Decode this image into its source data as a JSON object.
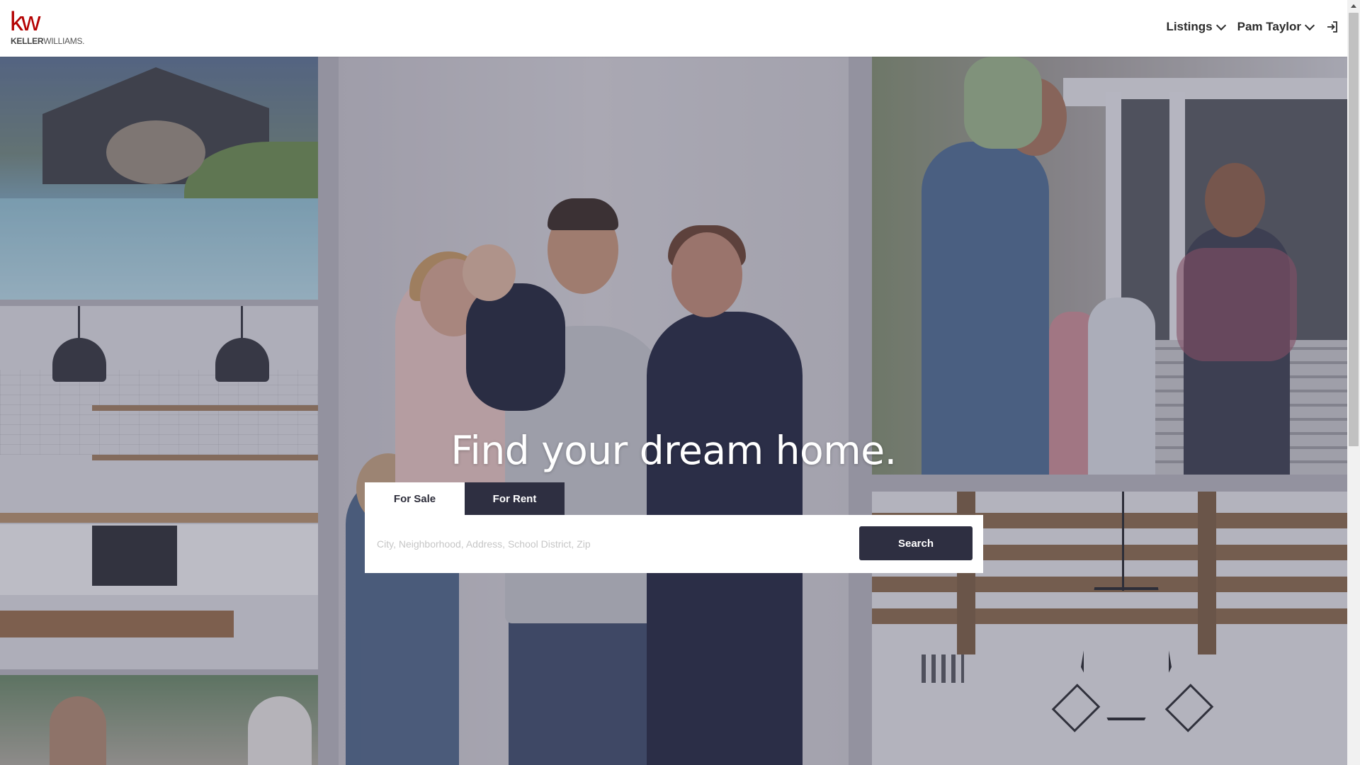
{
  "brand": {
    "logo_mark": "kw",
    "logo_name_bold": "KELLER",
    "logo_name_rest": "WILLIAMS.",
    "color": "#b40101"
  },
  "nav": {
    "listings_label": "Listings",
    "user_label": "Pam Taylor",
    "icons": [
      "chevron-down-icon",
      "chevron-down-icon",
      "sign-in-icon"
    ]
  },
  "hero": {
    "headline": "Find your dream home.",
    "tabs": [
      {
        "label": "For Sale",
        "active": true
      },
      {
        "label": "For Rent",
        "active": false
      }
    ],
    "search_placeholder": "City, Neighborhood, Address, School District, Zip",
    "search_value": "",
    "search_button_label": "Search"
  },
  "colors": {
    "primary_dark": "#2e2f41",
    "text_dark": "#2b2b2b"
  }
}
